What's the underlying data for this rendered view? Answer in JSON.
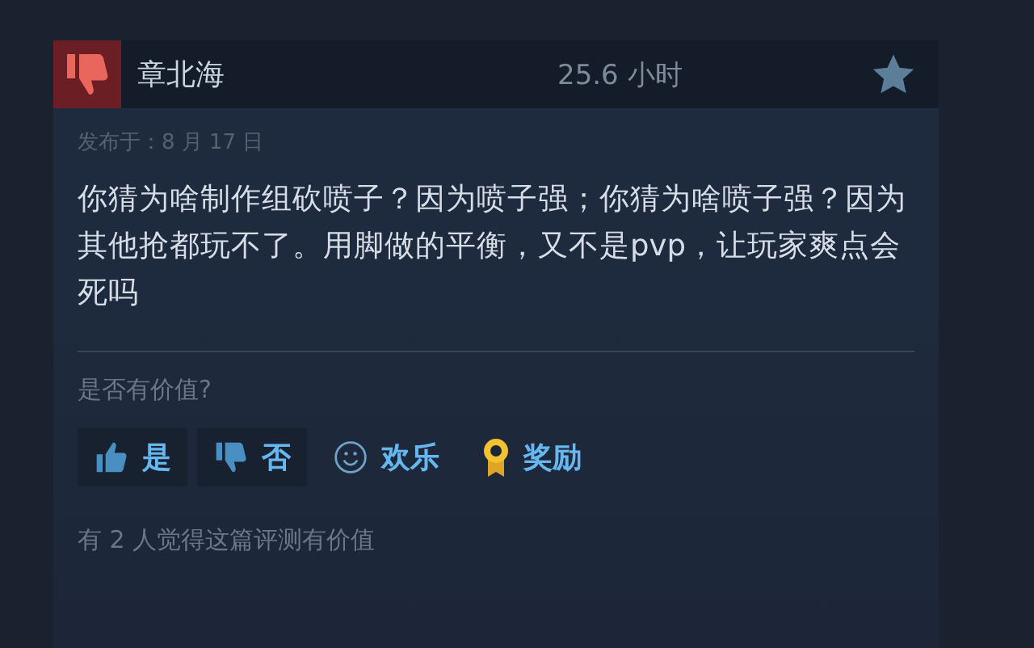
{
  "review": {
    "recommended": false,
    "author": "章北海",
    "hours": "25.6 小时",
    "posted": "发布于：8 月 17 日",
    "text": "你猜为啥制作组砍喷子？因为喷子强；你猜为啥喷子强？因为其他抢都玩不了。用脚做的平衡，又不是pvp，让玩家爽点会死吗"
  },
  "helpful_prompt": "是否有价值?",
  "buttons": [
    {
      "kind": "yes",
      "label": "是"
    },
    {
      "kind": "no",
      "label": "否"
    },
    {
      "kind": "funny",
      "label": "欢乐"
    },
    {
      "kind": "award",
      "label": "奖励"
    }
  ],
  "footer": "有 2 人觉得这篇评测有价值"
}
